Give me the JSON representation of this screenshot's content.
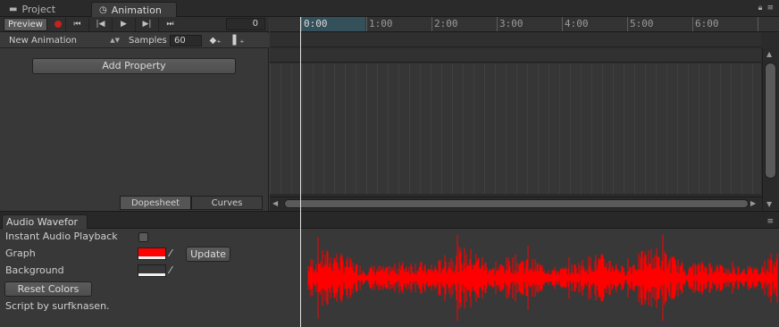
{
  "window_tabs": [
    {
      "label": "Project",
      "icon": "folder-icon"
    },
    {
      "label": "Animation",
      "icon": "clock-icon"
    }
  ],
  "toolbar": {
    "preview_label": "Preview",
    "frame_value": "0",
    "clip_name": "New Animation",
    "samples_label": "Samples",
    "samples_value": "60"
  },
  "left": {
    "add_property_label": "Add Property",
    "view_tabs": [
      "Dopesheet",
      "Curves"
    ]
  },
  "timeline": {
    "ruler_labels": [
      "0:00",
      "1:00",
      "2:00",
      "3:00",
      "4:00",
      "5:00",
      "6:00"
    ]
  },
  "audio_panel": {
    "tab_label": "Audio Wavefor",
    "instant_playback_label": "Instant Audio Playback",
    "instant_playback_checked": false,
    "graph_label": "Graph",
    "graph_color": "#ff0000",
    "background_label": "Background",
    "background_color": "#383838",
    "update_label": "Update",
    "reset_label": "Reset Colors",
    "credit": "Script by surfknasen."
  }
}
